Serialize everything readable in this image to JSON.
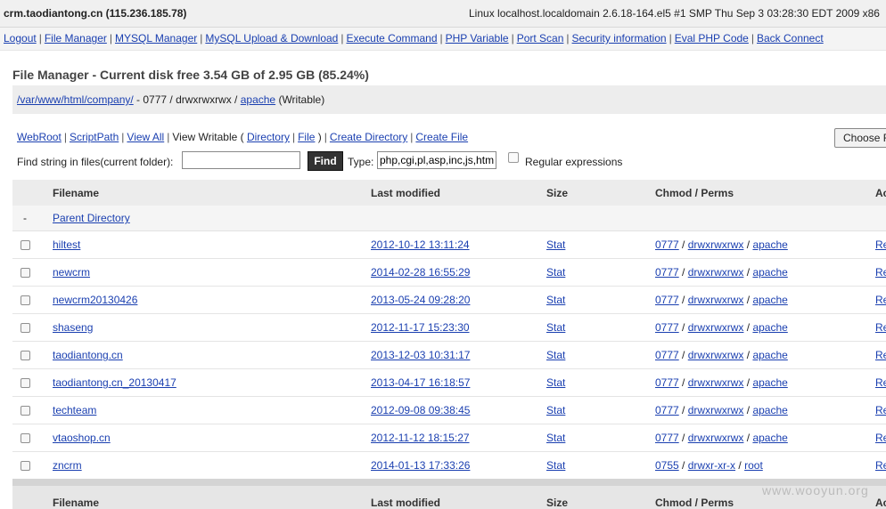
{
  "topbar": {
    "host": "crm.taodiantong.cn (115.236.185.78)",
    "sysinfo": "Linux localhost.localdomain 2.6.18-164.el5 #1 SMP Thu Sep 3 03:28:30 EDT 2009 x86"
  },
  "nav": [
    "Logout",
    "File Manager",
    "MYSQL Manager",
    "MySQL Upload & Download",
    "Execute Command",
    "PHP Variable",
    "Port Scan",
    "Security information",
    "Eval PHP Code",
    "Back Connect"
  ],
  "nav_sep": "|",
  "fm": {
    "title": "File Manager - Current disk free 3.54 GB of 2.95 GB (85.24%)",
    "path_link": "/var/www/html/company/",
    "path_perms": " - 0777 / drwxrwxrwx / ",
    "path_owner": "apache",
    "path_writable": " (Writable)"
  },
  "tools": {
    "webroot": "WebRoot",
    "scriptpath": "ScriptPath",
    "view_all": "View All",
    "view_writable_prefix": "View Writable (",
    "directory": "Directory",
    "file": "File",
    "view_writable_suffix": ")",
    "create_directory": "Create Directory",
    "create_file": "Create File",
    "sep": "|",
    "find_label": "Find string in files(current folder):",
    "find_value": "",
    "find_button": "Find",
    "type_label": "Type:",
    "type_value": "php,cgi,pl,asp,inc,js,htm",
    "regex_label": "Regular expressions",
    "choose_label": "Choose File"
  },
  "table": {
    "headers": {
      "filename": "Filename",
      "last_modified": "Last modified",
      "size": "Size",
      "chmod": "Chmod / Perms",
      "action": "Action"
    },
    "parent": {
      "dash": "-",
      "label": "Parent Directory"
    },
    "rows": [
      {
        "name": "hiltest",
        "modified": "2012-10-12 13:11:24",
        "size": "Stat",
        "chmod": "0777",
        "perms": "drwxrwxrwx",
        "owner": "apache",
        "action": "Rename"
      },
      {
        "name": "newcrm",
        "modified": "2014-02-28 16:55:29",
        "size": "Stat",
        "chmod": "0777",
        "perms": "drwxrwxrwx",
        "owner": "apache",
        "action": "Rename"
      },
      {
        "name": "newcrm20130426",
        "modified": "2013-05-24 09:28:20",
        "size": "Stat",
        "chmod": "0777",
        "perms": "drwxrwxrwx",
        "owner": "apache",
        "action": "Rename"
      },
      {
        "name": "shaseng",
        "modified": "2012-11-17 15:23:30",
        "size": "Stat",
        "chmod": "0777",
        "perms": "drwxrwxrwx",
        "owner": "apache",
        "action": "Rename"
      },
      {
        "name": "taodiantong.cn",
        "modified": "2013-12-03 10:31:17",
        "size": "Stat",
        "chmod": "0777",
        "perms": "drwxrwxrwx",
        "owner": "apache",
        "action": "Rename"
      },
      {
        "name": "taodiantong.cn_20130417",
        "modified": "2013-04-17 16:18:57",
        "size": "Stat",
        "chmod": "0777",
        "perms": "drwxrwxrwx",
        "owner": "apache",
        "action": "Rename"
      },
      {
        "name": "techteam",
        "modified": "2012-09-08 09:38:45",
        "size": "Stat",
        "chmod": "0777",
        "perms": "drwxrwxrwx",
        "owner": "apache",
        "action": "Rename"
      },
      {
        "name": "vtaoshop.cn",
        "modified": "2012-11-12 18:15:27",
        "size": "Stat",
        "chmod": "0777",
        "perms": "drwxrwxrwx",
        "owner": "apache",
        "action": "Rename"
      },
      {
        "name": "zncrm",
        "modified": "2014-01-13 17:33:26",
        "size": "Stat",
        "chmod": "0755",
        "perms": "drwxr-xr-x",
        "owner": "root",
        "action": "Rename"
      }
    ],
    "slash": "/"
  },
  "watermark": "www.wooyun.org"
}
